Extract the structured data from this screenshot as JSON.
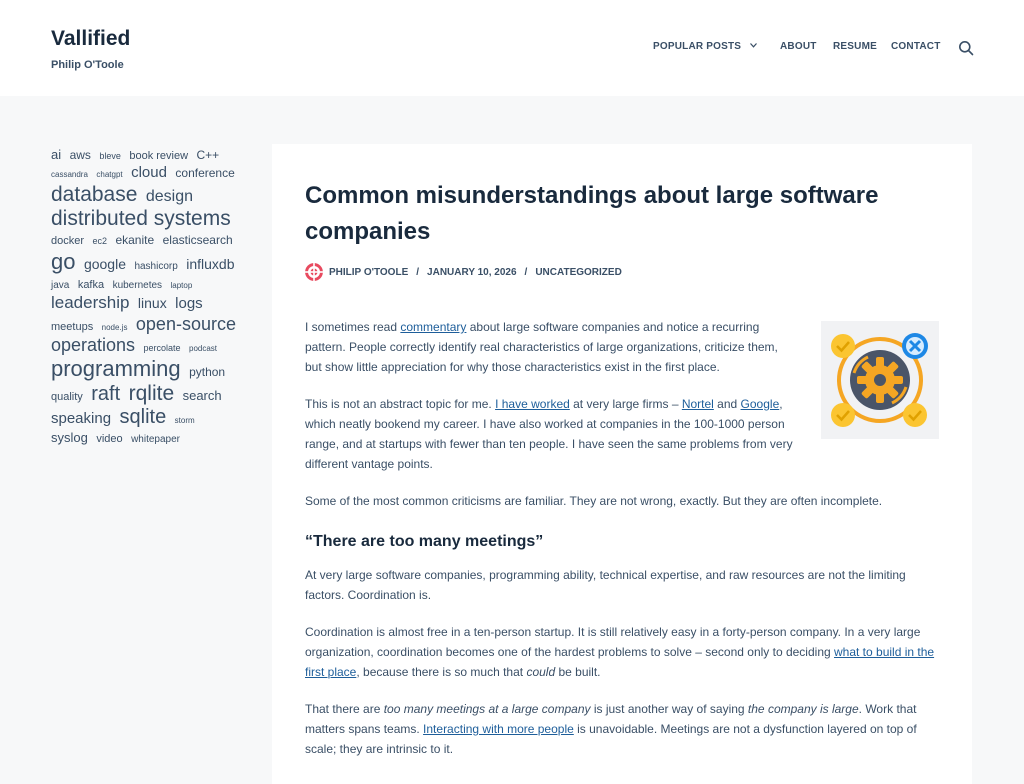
{
  "site": {
    "title": "Vallified",
    "tagline": "Philip O'Toole"
  },
  "nav": {
    "items": [
      {
        "label": "POPULAR POSTS"
      },
      {
        "label": "ABOUT"
      },
      {
        "label": "RESUME"
      },
      {
        "label": "CONTACT"
      }
    ],
    "search_icon": "search-icon",
    "dropdown_icon": "chevron-down-icon"
  },
  "sidebar": {
    "tags": [
      {
        "label": "ai",
        "size": 13
      },
      {
        "label": "aws",
        "size": 12
      },
      {
        "label": "bleve",
        "size": 9
      },
      {
        "label": "book review",
        "size": 11
      },
      {
        "label": "C++",
        "size": 12
      },
      {
        "label": "cassandra",
        "size": 8
      },
      {
        "label": "chatgpt",
        "size": 8
      },
      {
        "label": "cloud",
        "size": 15
      },
      {
        "label": "conference",
        "size": 12
      },
      {
        "label": "database",
        "size": 21
      },
      {
        "label": "design",
        "size": 16
      },
      {
        "label": "distributed systems",
        "size": 21
      },
      {
        "label": "docker",
        "size": 11
      },
      {
        "label": "ec2",
        "size": 9
      },
      {
        "label": "ekanite",
        "size": 12
      },
      {
        "label": "elasticsearch",
        "size": 12
      },
      {
        "label": "go",
        "size": 22
      },
      {
        "label": "google",
        "size": 14
      },
      {
        "label": "hashicorp",
        "size": 10
      },
      {
        "label": "influxdb",
        "size": 14
      },
      {
        "label": "java",
        "size": 10
      },
      {
        "label": "kafka",
        "size": 11
      },
      {
        "label": "kubernetes",
        "size": 10
      },
      {
        "label": "laptop",
        "size": 8
      },
      {
        "label": "leadership",
        "size": 17
      },
      {
        "label": "linux",
        "size": 14
      },
      {
        "label": "logs",
        "size": 15
      },
      {
        "label": "meetups",
        "size": 11
      },
      {
        "label": "node.js",
        "size": 8
      },
      {
        "label": "open-source",
        "size": 18
      },
      {
        "label": "operations",
        "size": 18
      },
      {
        "label": "percolate",
        "size": 9
      },
      {
        "label": "podcast",
        "size": 8
      },
      {
        "label": "programming",
        "size": 22
      },
      {
        "label": "python",
        "size": 12
      },
      {
        "label": "quality",
        "size": 11
      },
      {
        "label": "raft",
        "size": 20
      },
      {
        "label": "rqlite",
        "size": 21
      },
      {
        "label": "search",
        "size": 13
      },
      {
        "label": "speaking",
        "size": 15
      },
      {
        "label": "sqlite",
        "size": 20
      },
      {
        "label": "storm",
        "size": 8
      },
      {
        "label": "syslog",
        "size": 13
      },
      {
        "label": "video",
        "size": 11
      },
      {
        "label": "whitepaper",
        "size": 10
      }
    ]
  },
  "post": {
    "title": "Common misunderstandings about large software companies",
    "author": "PHILIP O'TOOLE",
    "date": "JANUARY 10, 2026",
    "category": "UNCATEGORIZED",
    "meta_separator": "/",
    "avatar_icon": "avatar-icon",
    "featured_icon": "gear-process-icon",
    "colors": {
      "accent_orange": "#f5a623",
      "icon_blue": "#1e88e5",
      "icon_dark": "#4a5568",
      "link": "#1e5e9a",
      "title": "#192a3d",
      "body": "#3a4f66"
    },
    "p1": {
      "a": "I sometimes read ",
      "link": "commentary",
      "b": " about large software companies and notice a recurring pattern. People correctly identify real characteristics of large organizations, criticize them, but show little appreciation for why those characteristics exist in the first place."
    },
    "p2": {
      "a": "This is not an abstract topic for me. ",
      "link1": "I have worked",
      "b": " at very large firms – ",
      "link2": "Nortel",
      "c": " and ",
      "link3": "Google",
      "d": ", which neatly bookend my career. I have also worked at companies in the 100-1000 person range, and at startups with fewer than ten people. I have seen the same problems from very different vantage points."
    },
    "p3": "Some of the most common criticisms are familiar. They are not wrong, exactly. But they are often incomplete.",
    "h2": "“There are too many meetings”",
    "p4": "At very large software companies, programming ability, technical expertise, and raw resources are not the limiting factors. Coordination is.",
    "p5": {
      "a": "Coordination is almost free in a ten-person startup. It is still relatively easy in a forty-person company. In a very large organization, coordination becomes one of the hardest problems to solve – second only to deciding ",
      "link": "what to build in the first place",
      "b": ", because there is so much that ",
      "em": "could",
      "c": " be built."
    },
    "p6": {
      "a": "That there are ",
      "em1": "too many meetings at a large company",
      "b": " is just another way of saying ",
      "em2": "the company is large",
      "c": ". Work that matters spans teams. ",
      "link": "Interacting with more people",
      "d": " is unavoidable. Meetings are not a dysfunction layered on top of scale; they are intrinsic to it."
    }
  }
}
